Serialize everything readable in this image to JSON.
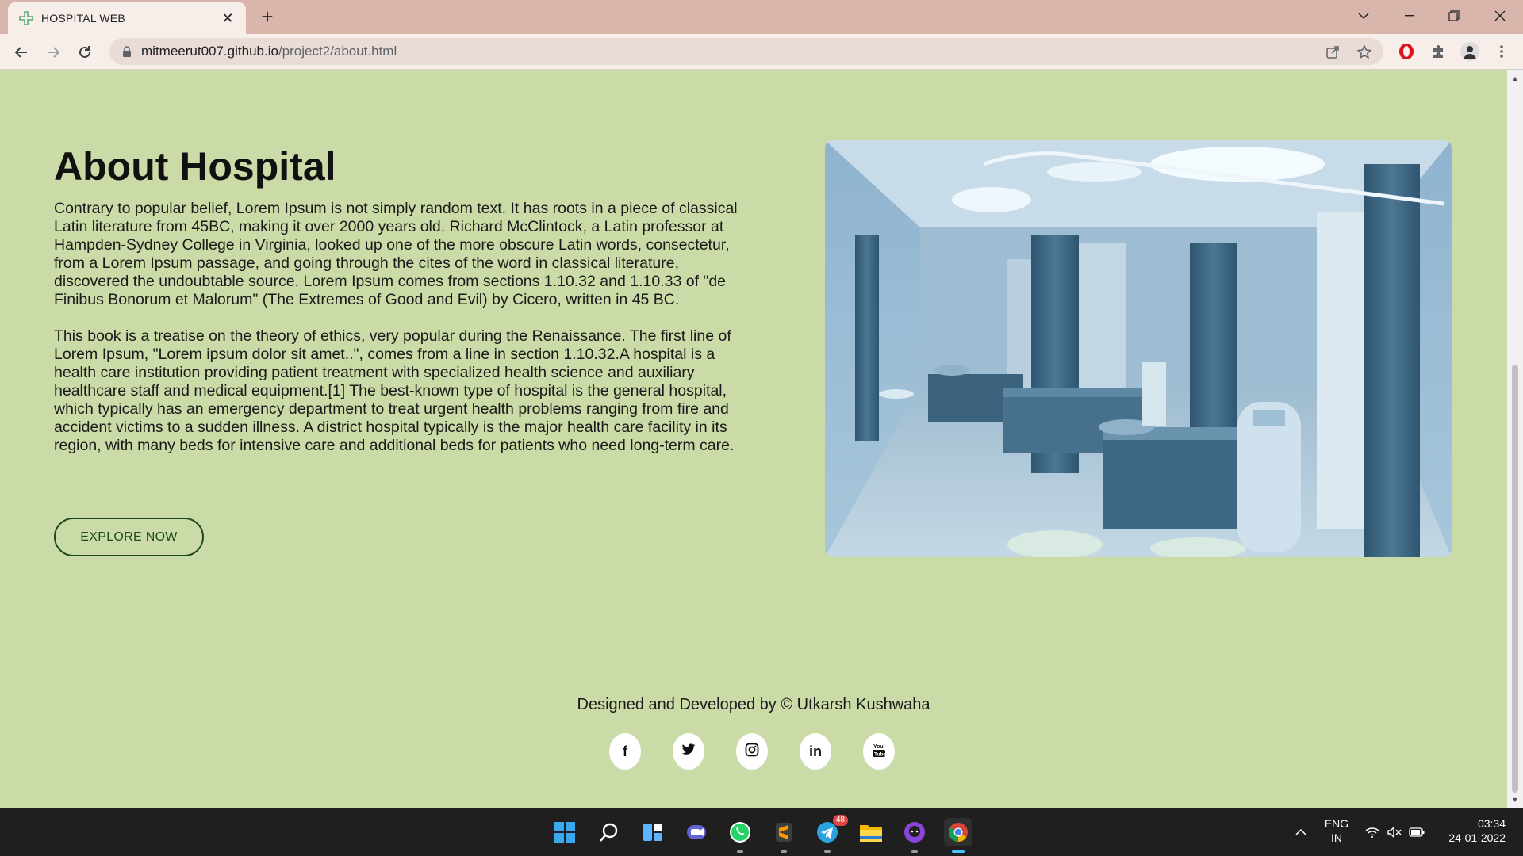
{
  "browser": {
    "tab_title": "HOSPITAL WEB",
    "url_host": "mitmeerut007.github.io",
    "url_path": "/project2/about.html"
  },
  "about": {
    "title": "About Hospital",
    "paragraph1": "Contrary to popular belief, Lorem Ipsum is not simply random text. It has roots in a piece of classical Latin literature from 45BC, making it over 2000 years old. Richard McClintock, a Latin professor at Hampden-Sydney College in Virginia, looked up one of the more obscure Latin words, consectetur, from a Lorem Ipsum passage, and going through the cites of the word in classical literature, discovered the undoubtable source. Lorem Ipsum comes from sections 1.10.32 and 1.10.33 of \"de Finibus Bonorum et Malorum\" (The Extremes of Good and Evil) by Cicero, written in 45 BC.",
    "paragraph2": "This book is a treatise on the theory of ethics, very popular during the Renaissance. The first line of Lorem Ipsum, \"Lorem ipsum dolor sit amet..\", comes from a line in section 1.10.32.A hospital is a health care institution providing patient treatment with specialized health science and auxiliary healthcare staff and medical equipment.[1] The best-known type of hospital is the general hospital, which typically has an emergency department to treat urgent health problems ranging from fire and accident victims to a sudden illness. A district hospital typically is the major health care facility in its region, with many beds for intensive care and additional beds for patients who need long-term care.",
    "button_label": "EXPLORE NOW"
  },
  "footer": {
    "credit": "Designed and Developed by © Utkarsh Kushwaha",
    "socials": [
      {
        "name": "facebook-icon",
        "glyph": "f"
      },
      {
        "name": "twitter-icon",
        "glyph": ""
      },
      {
        "name": "instagram-icon",
        "glyph": ""
      },
      {
        "name": "linkedin-icon",
        "glyph": "in"
      },
      {
        "name": "youtube-icon",
        "glyph": ""
      }
    ]
  },
  "taskbar": {
    "telegram_badge": "48",
    "lang_top": "ENG",
    "lang_bottom": "IN",
    "time": "03:34",
    "date": "24-01-2022"
  },
  "colors": {
    "page_bg": "#cadba7",
    "button_border": "#1f4a1f",
    "chrome_tab_strip": "#d9b6ac"
  }
}
